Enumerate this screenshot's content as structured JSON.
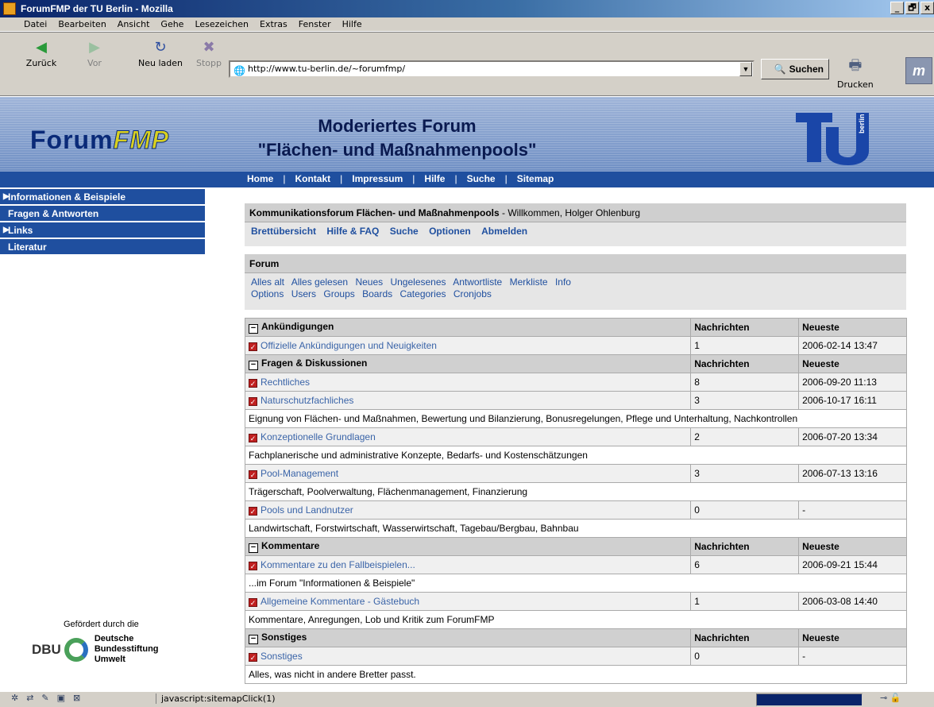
{
  "window": {
    "title": "ForumFMP der TU Berlin - Mozilla",
    "buttons": [
      "_",
      "🗗",
      "x"
    ]
  },
  "menubar": [
    "Datei",
    "Bearbeiten",
    "Ansicht",
    "Gehe",
    "Lesezeichen",
    "Extras",
    "Fenster",
    "Hilfe"
  ],
  "toolbar": {
    "back": "Zurück",
    "forward": "Vor",
    "reload": "Neu laden",
    "stop": "Stopp",
    "url": "http://www.tu-berlin.de/~forumfmp/",
    "search": "Suchen",
    "print": "Drucken"
  },
  "header": {
    "logo_a": "Forum",
    "logo_b": "FMP",
    "title_line1": "Moderiertes Forum",
    "title_line2": "\"Flächen- und Maßnahmenpools\"",
    "tu_mark": "berlin"
  },
  "topnav": [
    "Home",
    "Kontakt",
    "Impressum",
    "Hilfe",
    "Suche",
    "Sitemap"
  ],
  "leftmenu": [
    {
      "label": "Informationen & Beispiele",
      "arrow": true
    },
    {
      "label": "Fragen & Antworten",
      "arrow": false
    },
    {
      "label": "Links",
      "arrow": true
    },
    {
      "label": "Literatur",
      "arrow": false
    }
  ],
  "funder": {
    "label": "Gefördert durch die",
    "abbr": "DBU",
    "name1": "Deutsche",
    "name2": "Bundesstiftung",
    "name3": "Umwelt"
  },
  "board": {
    "title": "Kommunikationsforum Flächen- und Maßnahmenpools",
    "welcome": " - Willkommen, Holger Ohlenburg",
    "links": [
      "Brettübersicht",
      "Hilfe & FAQ",
      "Suche",
      "Optionen",
      "Abmelden"
    ]
  },
  "forum": {
    "title": "Forum",
    "links1": [
      "Alles alt",
      "Alles gelesen",
      "Neues",
      "Ungelesenes",
      "Antwortliste",
      "Merkliste",
      "Info"
    ],
    "links2": [
      "Options",
      "Users",
      "Groups",
      "Boards",
      "Categories",
      "Cronjobs"
    ]
  },
  "table": {
    "col_messages": "Nachrichten",
    "col_latest": "Neueste",
    "rows": [
      {
        "type": "cat",
        "name": "Ankündigungen"
      },
      {
        "type": "item",
        "name": "Offizielle Ankündigungen und Neuigkeiten",
        "count": "1",
        "latest": "2006-02-14 13:47"
      },
      {
        "type": "cat",
        "name": "Fragen & Diskussionen"
      },
      {
        "type": "item",
        "name": "Rechtliches",
        "count": "8",
        "latest": "2006-09-20 11:13"
      },
      {
        "type": "item",
        "name": "Naturschutzfachliches",
        "count": "3",
        "latest": "2006-10-17 16:11"
      },
      {
        "type": "desc",
        "text": "Eignung von Flächen- und Maßnahmen, Bewertung und Bilanzierung, Bonusregelungen, Pflege und Unterhaltung, Nachkontrollen"
      },
      {
        "type": "item",
        "name": "Konzeptionelle Grundlagen",
        "count": "2",
        "latest": "2006-07-20 13:34"
      },
      {
        "type": "desc",
        "text": "Fachplanerische und administrative Konzepte, Bedarfs- und Kostenschätzungen"
      },
      {
        "type": "item",
        "name": "Pool-Management",
        "count": "3",
        "latest": "2006-07-13 13:16"
      },
      {
        "type": "desc",
        "text": "Trägerschaft, Poolverwaltung, Flächenmanagement, Finanzierung"
      },
      {
        "type": "item",
        "name": "Pools und Landnutzer",
        "count": "0",
        "latest": "-"
      },
      {
        "type": "desc",
        "text": "Landwirtschaft, Forstwirtschaft, Wasserwirtschaft, Tagebau/Bergbau, Bahnbau"
      },
      {
        "type": "cat",
        "name": "Kommentare"
      },
      {
        "type": "item",
        "name": "Kommentare zu den Fallbeispielen...",
        "count": "6",
        "latest": "2006-09-21 15:44"
      },
      {
        "type": "desc",
        "text": "...im Forum \"Informationen & Beispiele\""
      },
      {
        "type": "item",
        "name": "Allgemeine Kommentare - Gästebuch",
        "count": "1",
        "latest": "2006-03-08 14:40"
      },
      {
        "type": "desc",
        "text": "Kommentare, Anregungen, Lob und Kritik zum ForumFMP"
      },
      {
        "type": "cat",
        "name": "Sonstiges"
      },
      {
        "type": "item",
        "name": "Sonstiges",
        "count": "0",
        "latest": "-"
      },
      {
        "type": "desc",
        "text": "Alles, was nicht in andere Bretter passt."
      }
    ]
  },
  "statusbar": {
    "text": "javascript:sitemapClick(1)"
  }
}
